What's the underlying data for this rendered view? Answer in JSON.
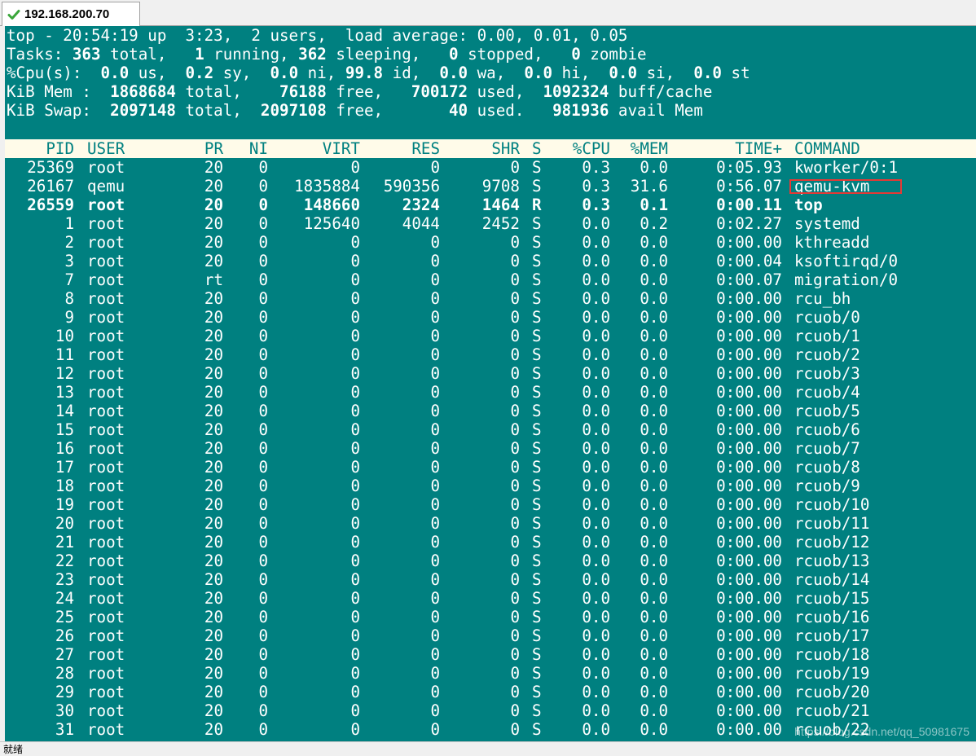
{
  "tab": {
    "title": "192.168.200.70",
    "icon": "check-icon",
    "icon_color": "#3aa63a"
  },
  "colors": {
    "terminal_bg": "#008080",
    "terminal_fg": "#ffffff",
    "header_bg": "#fffbe9",
    "highlight_box": "#e53935"
  },
  "summary": {
    "line1": "top - 20:54:19 up  3:23,  2 users,  load average: 0.00, 0.01, 0.05",
    "line2": [
      {
        "t": "Tasks: ",
        "b": false
      },
      {
        "t": "363",
        "b": true
      },
      {
        "t": " total,   ",
        "b": false
      },
      {
        "t": "1",
        "b": true
      },
      {
        "t": " running, ",
        "b": false
      },
      {
        "t": "362",
        "b": true
      },
      {
        "t": " sleeping,   ",
        "b": false
      },
      {
        "t": "0",
        "b": true
      },
      {
        "t": " stopped,   ",
        "b": false
      },
      {
        "t": "0",
        "b": true
      },
      {
        "t": " zombie",
        "b": false
      }
    ],
    "line3": [
      {
        "t": "%Cpu(s):  ",
        "b": false
      },
      {
        "t": "0.0",
        "b": true
      },
      {
        "t": " us,  ",
        "b": false
      },
      {
        "t": "0.2",
        "b": true
      },
      {
        "t": " sy,  ",
        "b": false
      },
      {
        "t": "0.0",
        "b": true
      },
      {
        "t": " ni, ",
        "b": false
      },
      {
        "t": "99.8",
        "b": true
      },
      {
        "t": " id,  ",
        "b": false
      },
      {
        "t": "0.0",
        "b": true
      },
      {
        "t": " wa,  ",
        "b": false
      },
      {
        "t": "0.0",
        "b": true
      },
      {
        "t": " hi,  ",
        "b": false
      },
      {
        "t": "0.0",
        "b": true
      },
      {
        "t": " si,  ",
        "b": false
      },
      {
        "t": "0.0",
        "b": true
      },
      {
        "t": " st",
        "b": false
      }
    ],
    "line4": [
      {
        "t": "KiB Mem :  ",
        "b": false
      },
      {
        "t": "1868684",
        "b": true
      },
      {
        "t": " total,    ",
        "b": false
      },
      {
        "t": "76188",
        "b": true
      },
      {
        "t": " free,   ",
        "b": false
      },
      {
        "t": "700172",
        "b": true
      },
      {
        "t": " used,  ",
        "b": false
      },
      {
        "t": "1092324",
        "b": true
      },
      {
        "t": " buff/cache",
        "b": false
      }
    ],
    "line5": [
      {
        "t": "KiB Swap:  ",
        "b": false
      },
      {
        "t": "2097148",
        "b": true
      },
      {
        "t": " total,  ",
        "b": false
      },
      {
        "t": "2097108",
        "b": true
      },
      {
        "t": " free,       ",
        "b": false
      },
      {
        "t": "40",
        "b": true
      },
      {
        "t": " used.   ",
        "b": false
      },
      {
        "t": "981936",
        "b": true
      },
      {
        "t": " avail Mem",
        "b": false
      }
    ]
  },
  "columns": [
    "PID",
    "USER",
    "PR",
    "NI",
    "VIRT",
    "RES",
    "SHR",
    "S",
    "%CPU",
    "%MEM",
    "TIME+",
    "COMMAND"
  ],
  "processes": [
    [
      "25369",
      "root",
      "20",
      "0",
      "0",
      "0",
      "0",
      "S",
      "0.3",
      "0.0",
      "0:05.93",
      "kworker/0:1"
    ],
    [
      "26167",
      "qemu",
      "20",
      "0",
      "1835884",
      "590356",
      "9708",
      "S",
      "0.3",
      "31.6",
      "0:56.07",
      "qemu-kvm"
    ],
    [
      "26559",
      "root",
      "20",
      "0",
      "148660",
      "2324",
      "1464",
      "R",
      "0.3",
      "0.1",
      "0:00.11",
      "top"
    ],
    [
      "1",
      "root",
      "20",
      "0",
      "125640",
      "4044",
      "2452",
      "S",
      "0.0",
      "0.2",
      "0:02.27",
      "systemd"
    ],
    [
      "2",
      "root",
      "20",
      "0",
      "0",
      "0",
      "0",
      "S",
      "0.0",
      "0.0",
      "0:00.00",
      "kthreadd"
    ],
    [
      "3",
      "root",
      "20",
      "0",
      "0",
      "0",
      "0",
      "S",
      "0.0",
      "0.0",
      "0:00.04",
      "ksoftirqd/0"
    ],
    [
      "7",
      "root",
      "rt",
      "0",
      "0",
      "0",
      "0",
      "S",
      "0.0",
      "0.0",
      "0:00.07",
      "migration/0"
    ],
    [
      "8",
      "root",
      "20",
      "0",
      "0",
      "0",
      "0",
      "S",
      "0.0",
      "0.0",
      "0:00.00",
      "rcu_bh"
    ],
    [
      "9",
      "root",
      "20",
      "0",
      "0",
      "0",
      "0",
      "S",
      "0.0",
      "0.0",
      "0:00.00",
      "rcuob/0"
    ],
    [
      "10",
      "root",
      "20",
      "0",
      "0",
      "0",
      "0",
      "S",
      "0.0",
      "0.0",
      "0:00.00",
      "rcuob/1"
    ],
    [
      "11",
      "root",
      "20",
      "0",
      "0",
      "0",
      "0",
      "S",
      "0.0",
      "0.0",
      "0:00.00",
      "rcuob/2"
    ],
    [
      "12",
      "root",
      "20",
      "0",
      "0",
      "0",
      "0",
      "S",
      "0.0",
      "0.0",
      "0:00.00",
      "rcuob/3"
    ],
    [
      "13",
      "root",
      "20",
      "0",
      "0",
      "0",
      "0",
      "S",
      "0.0",
      "0.0",
      "0:00.00",
      "rcuob/4"
    ],
    [
      "14",
      "root",
      "20",
      "0",
      "0",
      "0",
      "0",
      "S",
      "0.0",
      "0.0",
      "0:00.00",
      "rcuob/5"
    ],
    [
      "15",
      "root",
      "20",
      "0",
      "0",
      "0",
      "0",
      "S",
      "0.0",
      "0.0",
      "0:00.00",
      "rcuob/6"
    ],
    [
      "16",
      "root",
      "20",
      "0",
      "0",
      "0",
      "0",
      "S",
      "0.0",
      "0.0",
      "0:00.00",
      "rcuob/7"
    ],
    [
      "17",
      "root",
      "20",
      "0",
      "0",
      "0",
      "0",
      "S",
      "0.0",
      "0.0",
      "0:00.00",
      "rcuob/8"
    ],
    [
      "18",
      "root",
      "20",
      "0",
      "0",
      "0",
      "0",
      "S",
      "0.0",
      "0.0",
      "0:00.00",
      "rcuob/9"
    ],
    [
      "19",
      "root",
      "20",
      "0",
      "0",
      "0",
      "0",
      "S",
      "0.0",
      "0.0",
      "0:00.00",
      "rcuob/10"
    ],
    [
      "20",
      "root",
      "20",
      "0",
      "0",
      "0",
      "0",
      "S",
      "0.0",
      "0.0",
      "0:00.00",
      "rcuob/11"
    ],
    [
      "21",
      "root",
      "20",
      "0",
      "0",
      "0",
      "0",
      "S",
      "0.0",
      "0.0",
      "0:00.00",
      "rcuob/12"
    ],
    [
      "22",
      "root",
      "20",
      "0",
      "0",
      "0",
      "0",
      "S",
      "0.0",
      "0.0",
      "0:00.00",
      "rcuob/13"
    ],
    [
      "23",
      "root",
      "20",
      "0",
      "0",
      "0",
      "0",
      "S",
      "0.0",
      "0.0",
      "0:00.00",
      "rcuob/14"
    ],
    [
      "24",
      "root",
      "20",
      "0",
      "0",
      "0",
      "0",
      "S",
      "0.0",
      "0.0",
      "0:00.00",
      "rcuob/15"
    ],
    [
      "25",
      "root",
      "20",
      "0",
      "0",
      "0",
      "0",
      "S",
      "0.0",
      "0.0",
      "0:00.00",
      "rcuob/16"
    ],
    [
      "26",
      "root",
      "20",
      "0",
      "0",
      "0",
      "0",
      "S",
      "0.0",
      "0.0",
      "0:00.00",
      "rcuob/17"
    ],
    [
      "27",
      "root",
      "20",
      "0",
      "0",
      "0",
      "0",
      "S",
      "0.0",
      "0.0",
      "0:00.00",
      "rcuob/18"
    ],
    [
      "28",
      "root",
      "20",
      "0",
      "0",
      "0",
      "0",
      "S",
      "0.0",
      "0.0",
      "0:00.00",
      "rcuob/19"
    ],
    [
      "29",
      "root",
      "20",
      "0",
      "0",
      "0",
      "0",
      "S",
      "0.0",
      "0.0",
      "0:00.00",
      "rcuob/20"
    ],
    [
      "30",
      "root",
      "20",
      "0",
      "0",
      "0",
      "0",
      "S",
      "0.0",
      "0.0",
      "0:00.00",
      "rcuob/21"
    ],
    [
      "31",
      "root",
      "20",
      "0",
      "0",
      "0",
      "0",
      "S",
      "0.0",
      "0.0",
      "0:00.00",
      "rcuob/22"
    ]
  ],
  "bold_row_pid": "26559",
  "highlighted_command": "qemu-kvm",
  "watermark": "https://blog.csdn.net/qq_50981675",
  "status": "就绪"
}
